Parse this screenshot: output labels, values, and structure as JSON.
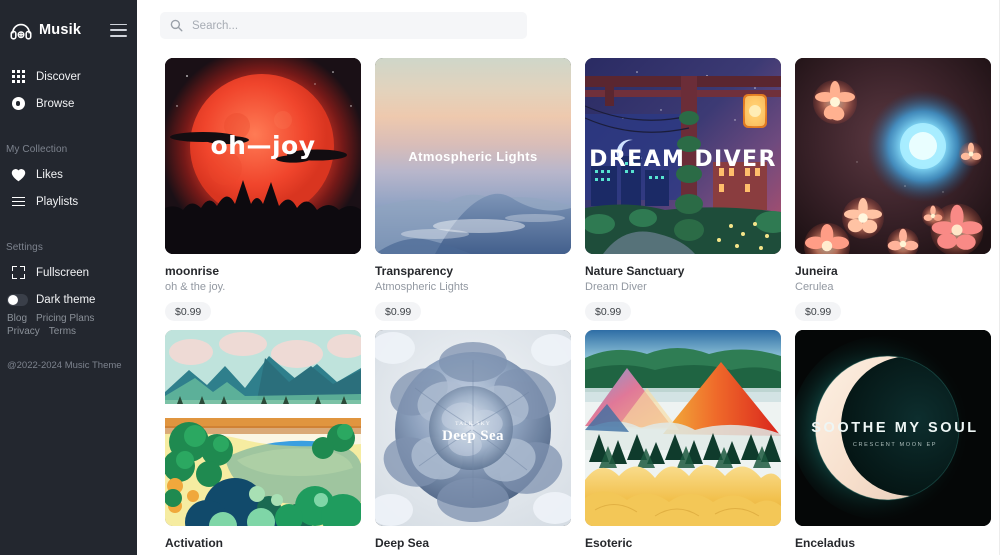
{
  "app": {
    "brand_name": "Musik",
    "brand_icon": "headphones-icon",
    "menu_icon": "hamburger-icon",
    "copyright": "@2022-2024 Music Theme"
  },
  "sidebar": {
    "nav": [
      {
        "label": "Discover",
        "icon": "grid-icon"
      },
      {
        "label": "Browse",
        "icon": "disc-icon"
      }
    ],
    "collection_title": "My Collection",
    "collection": [
      {
        "label": "Likes",
        "icon": "heart-icon"
      },
      {
        "label": "Playlists",
        "icon": "list-icon"
      }
    ],
    "settings_title": "Settings",
    "settings": [
      {
        "label": "Fullscreen",
        "icon": "fullscreen-icon"
      }
    ],
    "theme_toggle": {
      "label": "Dark theme",
      "icon": "toggle-icon",
      "state": "on"
    },
    "links": [
      "Blog",
      "Pricing Plans",
      "Privacy",
      "Terms"
    ]
  },
  "search": {
    "placeholder": "Search...",
    "value": "",
    "icon": "search-icon"
  },
  "colors": {
    "sidebar_bg": "#23272f",
    "page_bg": "#ffffff",
    "search_bg": "#f5f6f8",
    "price_bg": "#f3f4f6",
    "title_text": "#26282c",
    "sub_text": "#9298a1"
  },
  "albums": [
    {
      "title": "moonrise",
      "artist": "oh & the joy.",
      "price": "$0.99",
      "art_text": "oh — joy",
      "art_kind": "red-moon-forest"
    },
    {
      "title": "Transparency",
      "artist": "Atmospheric Lights",
      "price": "$0.99",
      "art_text": "Atmospheric Lights",
      "art_kind": "pastel-mountain-haze"
    },
    {
      "title": "Nature Sanctuary",
      "artist": "Dream Diver",
      "price": "$0.99",
      "art_text": "DREAM DIVER",
      "art_kind": "pixel-night-city"
    },
    {
      "title": "Juneira",
      "artist": "Cerulea",
      "price": "$0.99",
      "art_text": "",
      "art_kind": "glowing-flowers-orb"
    },
    {
      "title": "Activation",
      "artist": "",
      "price": "",
      "art_text": "",
      "art_kind": "painted-pool-landscape"
    },
    {
      "title": "Deep Sea",
      "artist": "",
      "price": "",
      "art_text": "Deep Sea",
      "art_text_small": "TALK SKY",
      "art_kind": "blue-peony-flower"
    },
    {
      "title": "Esoteric",
      "artist": "",
      "price": "",
      "art_text": "",
      "art_kind": "colorful-mountains"
    },
    {
      "title": "Enceladus",
      "artist": "",
      "price": "",
      "art_text": "SOOTHE MY SOUL",
      "art_text_small": "CRESCENT MOON EP",
      "art_kind": "crescent-moon-dark"
    }
  ]
}
